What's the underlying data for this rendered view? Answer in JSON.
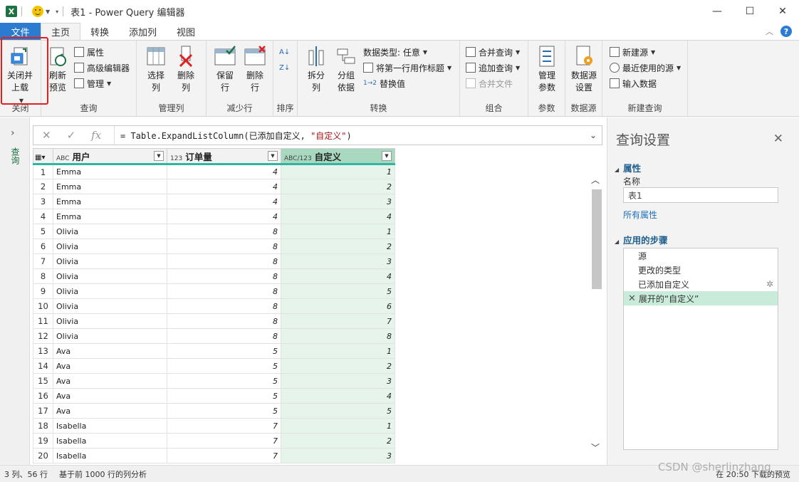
{
  "window": {
    "title": "表1 - Power Query 编辑器",
    "app_icon_letter": "X"
  },
  "tabs": [
    {
      "label": "文件"
    },
    {
      "label": "主页"
    },
    {
      "label": "转换"
    },
    {
      "label": "添加列"
    },
    {
      "label": "视图"
    }
  ],
  "ribbon": {
    "close_group": {
      "label": "关闭",
      "close_load": "关闭并\n上载"
    },
    "query_group": {
      "label": "查询",
      "refresh": "刷新\n预览",
      "properties": "属性",
      "advanced_editor": "高级编辑器",
      "manage": "管理"
    },
    "manage_cols_group": {
      "label": "管理列",
      "choose_cols": "选择\n列",
      "remove_cols": "删除\n列"
    },
    "reduce_rows_group": {
      "label": "减少行",
      "keep_rows": "保留\n行",
      "remove_rows": "删除\n行"
    },
    "sort_group": {
      "label": "排序"
    },
    "transform_group": {
      "label": "转换",
      "split": "拆分\n列",
      "group_by": "分组\n依据",
      "data_type": "数据类型: 任意",
      "first_row_header": "将第一行用作标题",
      "replace_values": "替换值"
    },
    "combine_group": {
      "label": "组合",
      "merge_queries": "合并查询",
      "append_queries": "追加查询",
      "combine_files": "合并文件"
    },
    "params_group": {
      "label": "参数",
      "manage_params": "管理\n参数"
    },
    "datasource_group": {
      "label": "数据源",
      "ds_settings": "数据源\n设置"
    },
    "newquery_group": {
      "label": "新建查询",
      "new_source": "新建源",
      "recent_sources": "最近使用的源",
      "enter_data": "输入数据"
    }
  },
  "leftnav": {
    "label": "查询"
  },
  "formula": {
    "prefix": "= Table.ExpandListColumn(已添加自定义, ",
    "string": "\"自定义\"",
    "suffix": ")"
  },
  "columns": [
    {
      "type": "ABC",
      "name": "用户"
    },
    {
      "type": "123",
      "name": "订单量"
    },
    {
      "type": "ABC/123",
      "name": "自定义"
    }
  ],
  "rows": [
    [
      "1",
      "Emma",
      "4",
      "1"
    ],
    [
      "2",
      "Emma",
      "4",
      "2"
    ],
    [
      "3",
      "Emma",
      "4",
      "3"
    ],
    [
      "4",
      "Emma",
      "4",
      "4"
    ],
    [
      "5",
      "Olivia",
      "8",
      "1"
    ],
    [
      "6",
      "Olivia",
      "8",
      "2"
    ],
    [
      "7",
      "Olivia",
      "8",
      "3"
    ],
    [
      "8",
      "Olivia",
      "8",
      "4"
    ],
    [
      "9",
      "Olivia",
      "8",
      "5"
    ],
    [
      "10",
      "Olivia",
      "8",
      "6"
    ],
    [
      "11",
      "Olivia",
      "8",
      "7"
    ],
    [
      "12",
      "Olivia",
      "8",
      "8"
    ],
    [
      "13",
      "Ava",
      "5",
      "1"
    ],
    [
      "14",
      "Ava",
      "5",
      "2"
    ],
    [
      "15",
      "Ava",
      "5",
      "3"
    ],
    [
      "16",
      "Ava",
      "5",
      "4"
    ],
    [
      "17",
      "Ava",
      "5",
      "5"
    ],
    [
      "18",
      "Isabella",
      "7",
      "1"
    ],
    [
      "19",
      "Isabella",
      "7",
      "2"
    ],
    [
      "20",
      "Isabella",
      "7",
      "3"
    ]
  ],
  "query_settings": {
    "title": "查询设置",
    "properties_label": "属性",
    "name_label": "名称",
    "name_value": "表1",
    "all_properties": "所有属性",
    "steps_label": "应用的步骤",
    "steps": [
      "源",
      "更改的类型",
      "已添加自定义",
      "展开的“自定义”"
    ]
  },
  "status": {
    "left1": "3 列、56 行",
    "left2": "基于前 1000 行的列分析",
    "right": "在 20:50 下载的预览"
  },
  "watermark": "CSDN @sherlinzhang"
}
